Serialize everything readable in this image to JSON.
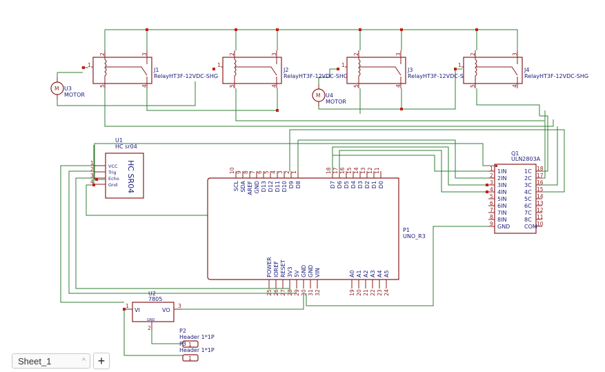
{
  "relays": [
    {
      "ref": "J1",
      "value": "RelayHT3F-12VDC-SHG"
    },
    {
      "ref": "J2",
      "value": "RelayHT3F-12VDC-SHG"
    },
    {
      "ref": "J3",
      "value": "RelayHT3F-12VDC-SHG"
    },
    {
      "ref": "J4",
      "value": "RelayHT3F-12VDC-SHG"
    }
  ],
  "relay_pins": [
    "1",
    "2",
    "3",
    "4",
    "5"
  ],
  "motors": [
    {
      "ref": "U3",
      "value": "MOTOR"
    },
    {
      "ref": "U4",
      "value": "MOTOR"
    }
  ],
  "sensor": {
    "ref": "U1",
    "value": "HC sr04",
    "body": "HC SR04",
    "pins": [
      "VCC",
      "Trig",
      "Echo",
      "Gnd"
    ],
    "nums": [
      "1",
      "2",
      "3",
      "4"
    ]
  },
  "driver": {
    "ref": "Q1",
    "value": "ULN2803A",
    "left_pins": [
      "1IN",
      "2IN",
      "3IN",
      "4IN",
      "5IN",
      "6IN",
      "7IN",
      "8IN",
      "GND"
    ],
    "left_nums": [
      "1",
      "2",
      "3",
      "4",
      "5",
      "6",
      "7",
      "8",
      "9"
    ],
    "right_pins": [
      "1C",
      "2C",
      "3C",
      "4C",
      "5C",
      "6C",
      "7C",
      "8C",
      "COM"
    ],
    "right_nums": [
      "18",
      "17",
      "16",
      "15",
      "14",
      "13",
      "12",
      "11",
      "10"
    ]
  },
  "arduino": {
    "ref": "P1",
    "value": "UNO_R3",
    "top_left_pins": [
      "SCL",
      "SDA",
      "AREF",
      "GND",
      "D13",
      "D12",
      "D11",
      "D10",
      "D9",
      "D8"
    ],
    "top_left_nums": [
      "10",
      "9",
      "8",
      "7",
      "6",
      "5",
      "4",
      "3",
      "2",
      "1"
    ],
    "top_right_pins": [
      "D7",
      "D6",
      "D5",
      "D4",
      "D3",
      "D2",
      "D1",
      "D0"
    ],
    "top_right_nums": [
      "18",
      "17",
      "16",
      "15",
      "14",
      "13",
      "12",
      "11"
    ],
    "bottom_left_pins": [
      "POWER",
      "IOREF",
      "RESET",
      "3V3",
      "5V",
      "GND",
      "GND",
      "VIN"
    ],
    "bottom_left_nums": [
      "25",
      "26",
      "27",
      "28",
      "29",
      "30",
      "31",
      "32"
    ],
    "bottom_right_pins": [
      "A0",
      "A1",
      "A2",
      "A3",
      "A4",
      "A5"
    ],
    "bottom_right_nums": [
      "19",
      "20",
      "21",
      "22",
      "23",
      "24"
    ]
  },
  "regulator": {
    "ref": "U2",
    "value": "7805",
    "pins": [
      "VI",
      "VO",
      "GND"
    ],
    "nums": [
      "1",
      "3",
      "2"
    ]
  },
  "headers": [
    {
      "ref": "P2",
      "value": "Header 1*1P",
      "pin": "1"
    },
    {
      "ref": "P3",
      "value": "Header 1*1P",
      "pin": "1"
    }
  ],
  "sheet": {
    "tab": "Sheet_1",
    "add": "+",
    "chevron": "^"
  }
}
